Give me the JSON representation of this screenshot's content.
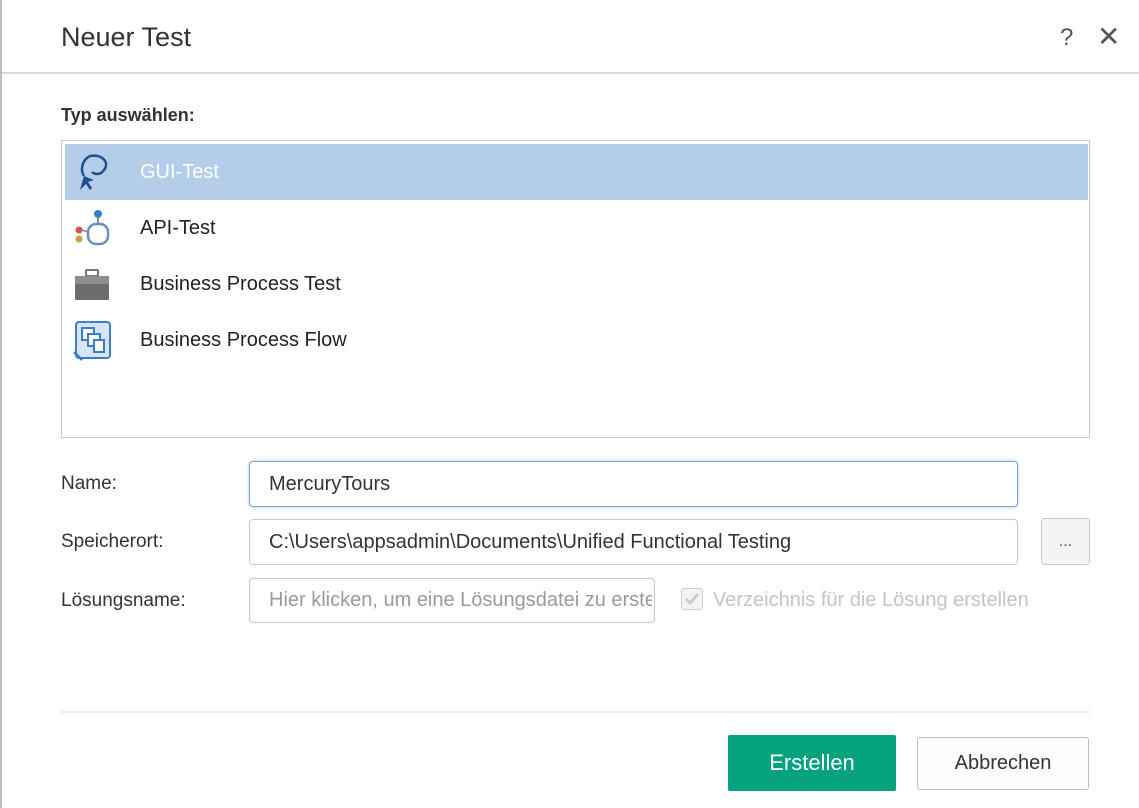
{
  "dialog": {
    "title": "Neuer Test",
    "help_label": "?",
    "close_label": "✕"
  },
  "type_section": {
    "label": "Typ auswählen:",
    "items": [
      {
        "label": "GUI-Test",
        "icon": "gui-test-icon",
        "selected": true
      },
      {
        "label": "API-Test",
        "icon": "api-test-icon",
        "selected": false
      },
      {
        "label": "Business Process Test",
        "icon": "business-process-test-icon",
        "selected": false
      },
      {
        "label": "Business Process Flow",
        "icon": "business-process-flow-icon",
        "selected": false
      }
    ]
  },
  "form": {
    "name_label": "Name:",
    "name_value": "MercuryTours",
    "location_label": "Speicherort:",
    "location_value": "C:\\Users\\appsadmin\\Documents\\Unified Functional Testing",
    "browse_label": "...",
    "solution_label": "Lösungsname:",
    "solution_placeholder": "Hier klicken, um eine Lösungsdatei zu erstellen",
    "create_dir_label": "Verzeichnis für die Lösung erstellen",
    "create_dir_checked": true
  },
  "buttons": {
    "create": "Erstellen",
    "cancel": "Abbrechen"
  },
  "colors": {
    "selection": "#b4cde9",
    "primary": "#04a27e",
    "focus_border": "#7aa7d8"
  }
}
